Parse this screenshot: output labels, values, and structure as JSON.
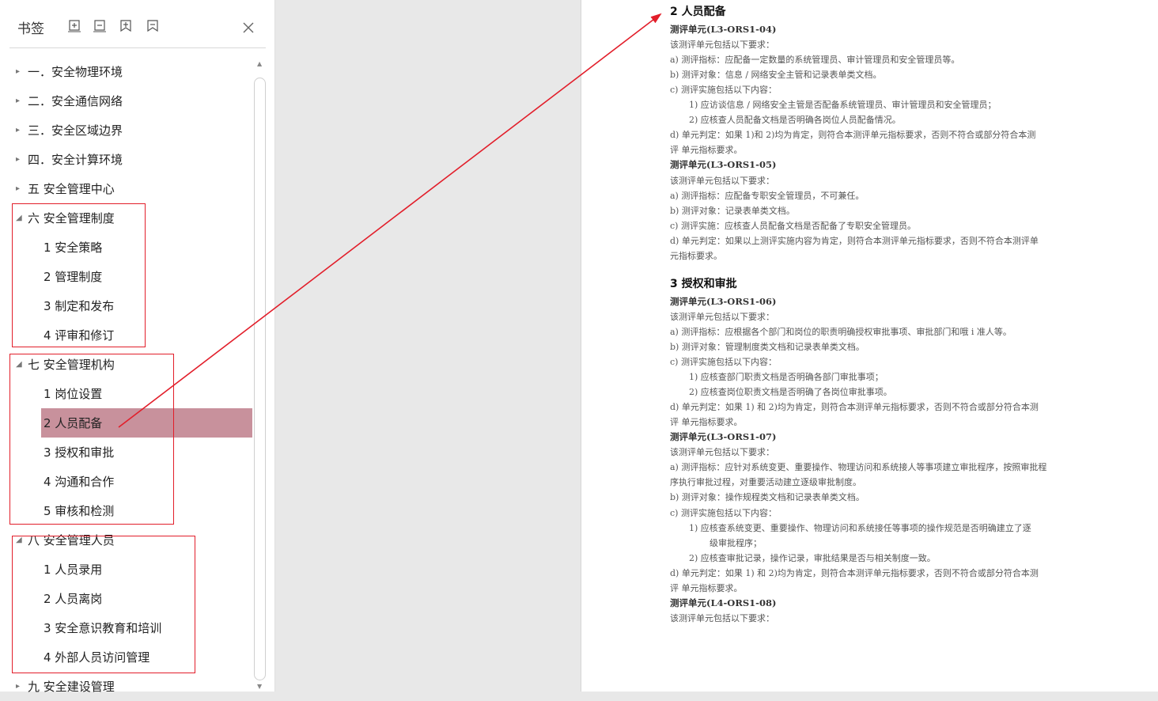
{
  "sidebar": {
    "title": "书签",
    "toolbar_icons": [
      "expand-all-icon",
      "collapse-all-icon",
      "add-bookmark-icon",
      "delete-bookmark-icon"
    ],
    "items": [
      {
        "label": "一．安全物理环境",
        "level": 0,
        "expanded": false
      },
      {
        "label": "二．安全通信网络",
        "level": 0,
        "expanded": false
      },
      {
        "label": "三．安全区域边界",
        "level": 0,
        "expanded": false
      },
      {
        "label": "四．安全计算环境",
        "level": 0,
        "expanded": false
      },
      {
        "label": "五 安全管理中心",
        "level": 0,
        "expanded": false
      },
      {
        "label": "六 安全管理制度",
        "level": 0,
        "expanded": true
      },
      {
        "label": "1 安全策略",
        "level": 1
      },
      {
        "label": "2 管理制度",
        "level": 1
      },
      {
        "label": "3 制定和发布",
        "level": 1
      },
      {
        "label": "4 评审和修订",
        "level": 1
      },
      {
        "label": "七 安全管理机构",
        "level": 0,
        "expanded": true
      },
      {
        "label": "1 岗位设置",
        "level": 1
      },
      {
        "label": "2 人员配备",
        "level": 1,
        "selected": true
      },
      {
        "label": "3 授权和审批",
        "level": 1
      },
      {
        "label": "4 沟通和合作",
        "level": 1
      },
      {
        "label": "5 审核和检测",
        "level": 1
      },
      {
        "label": "八 安全管理人员",
        "level": 0,
        "expanded": true
      },
      {
        "label": "1 人员录用",
        "level": 1
      },
      {
        "label": "2 人员离岗",
        "level": 1
      },
      {
        "label": "3 安全意识教育和培训",
        "level": 1
      },
      {
        "label": "4 外部人员访问管理",
        "level": 1
      },
      {
        "label": "九 安全建设管理",
        "level": 0,
        "expanded": false
      }
    ]
  },
  "document": {
    "lines": [
      {
        "kind": "h2",
        "text": "2 人员配备"
      },
      {
        "kind": "unit",
        "text": "测评单元(L3-ORS1-04)"
      },
      {
        "kind": "text",
        "text": "该测评单元包括以下要求："
      },
      {
        "kind": "text",
        "text": "a) 测评指标：应配备一定数量的系统管理员、审计管理员和安全管理员等。"
      },
      {
        "kind": "text",
        "text": "b) 测评对象：信息 / 网络安全主管和记录表单类文档。"
      },
      {
        "kind": "text",
        "text": "c) 测评实施包括以下内容："
      },
      {
        "kind": "indent",
        "text": "1) 应访谈信息 / 网络安全主管是否配备系统管理员、审计管理员和安全管理员；"
      },
      {
        "kind": "indent",
        "text": "2) 应核查人员配备文档是否明确各岗位人员配备情况。"
      },
      {
        "kind": "text",
        "text": "d) 单元判定：如果 1)和 2)均为肯定，则符合本测评单元指标要求，否则不符合或部分符合本测"
      },
      {
        "kind": "text",
        "text": "评 单元指标要求。"
      },
      {
        "kind": "unit",
        "text": "测评单元(L3-ORS1-05)"
      },
      {
        "kind": "text",
        "text": "该测评单元包括以下要求："
      },
      {
        "kind": "text",
        "text": "a) 测评指标：应配备专职安全管理员，不可兼任。"
      },
      {
        "kind": "text",
        "text": "b) 测评对象：记录表单类文档。"
      },
      {
        "kind": "text",
        "text": "c) 测评实施：应核查人员配备文档是否配备了专职安全管理员。"
      },
      {
        "kind": "text",
        "text": "d) 单元判定：如果以上测评实施内容为肯定，则符合本测评单元指标要求，否则不符合本测评单"
      },
      {
        "kind": "text",
        "text": "元指标要求。"
      },
      {
        "kind": "h2",
        "text": "3 授权和审批"
      },
      {
        "kind": "unit",
        "text": "测评单元(L3-ORS1-06)"
      },
      {
        "kind": "text",
        "text": "该测评单元包括以下要求："
      },
      {
        "kind": "text",
        "text": "a) 测评指标：应根据各个部门和岗位的职责明确授权审批事项、审批部门和哦 i 准人等。"
      },
      {
        "kind": "text",
        "text": "b) 测评对象：管理制度类文档和记录表单类文档。"
      },
      {
        "kind": "text",
        "text": "c) 测评实施包括以下内容："
      },
      {
        "kind": "indent",
        "text": "1) 应核查部门职责文档是否明确各部门审批事项；"
      },
      {
        "kind": "indent",
        "text": "2) 应核查岗位职责文档是否明确了各岗位审批事项。"
      },
      {
        "kind": "text",
        "text": "d) 单元判定：如果 1) 和 2)均为肯定，则符合本测评单元指标要求，否则不符合或部分符合本测"
      },
      {
        "kind": "text",
        "text": "评 单元指标要求。"
      },
      {
        "kind": "unit",
        "text": "测评单元(L3-ORS1-07)"
      },
      {
        "kind": "text",
        "text": "该测评单元包括以下要求："
      },
      {
        "kind": "text",
        "text": "a) 测评指标：应针对系统变更、重要操作、物理访问和系统接人等事项建立审批程序，按照审批程"
      },
      {
        "kind": "text",
        "text": "序执行审批过程，对重要活动建立逐级审批制度。"
      },
      {
        "kind": "text",
        "text": "b) 测评对象：操作规程类文档和记录表单类文档。"
      },
      {
        "kind": "text",
        "text": "c) 测评实施包括以下内容："
      },
      {
        "kind": "indent",
        "text": "1) 应核查系统变更、重要操作、物理访问和系统接任等事项的操作规范是否明确建立了逐"
      },
      {
        "kind": "indent2",
        "text": "级审批程序；"
      },
      {
        "kind": "indent",
        "text": "2) 应核查审批记录，操作记录，审批结果是否与相关制度一致。"
      },
      {
        "kind": "text",
        "text": "d) 单元判定：如果 1) 和 2)均为肯定，则符合本测评单元指标要求，否则不符合或部分符合本测"
      },
      {
        "kind": "text",
        "text": "评 单元指标要求。"
      },
      {
        "kind": "unit",
        "text": "测评单元(L4-ORS1-08)"
      },
      {
        "kind": "text",
        "text": "该测评单元包括以下要求："
      }
    ]
  },
  "colors": {
    "selection": "#c8919c",
    "annotation": "#e21e2a",
    "doc_background": "#ffffff",
    "gap_background": "#e8e8e8"
  }
}
